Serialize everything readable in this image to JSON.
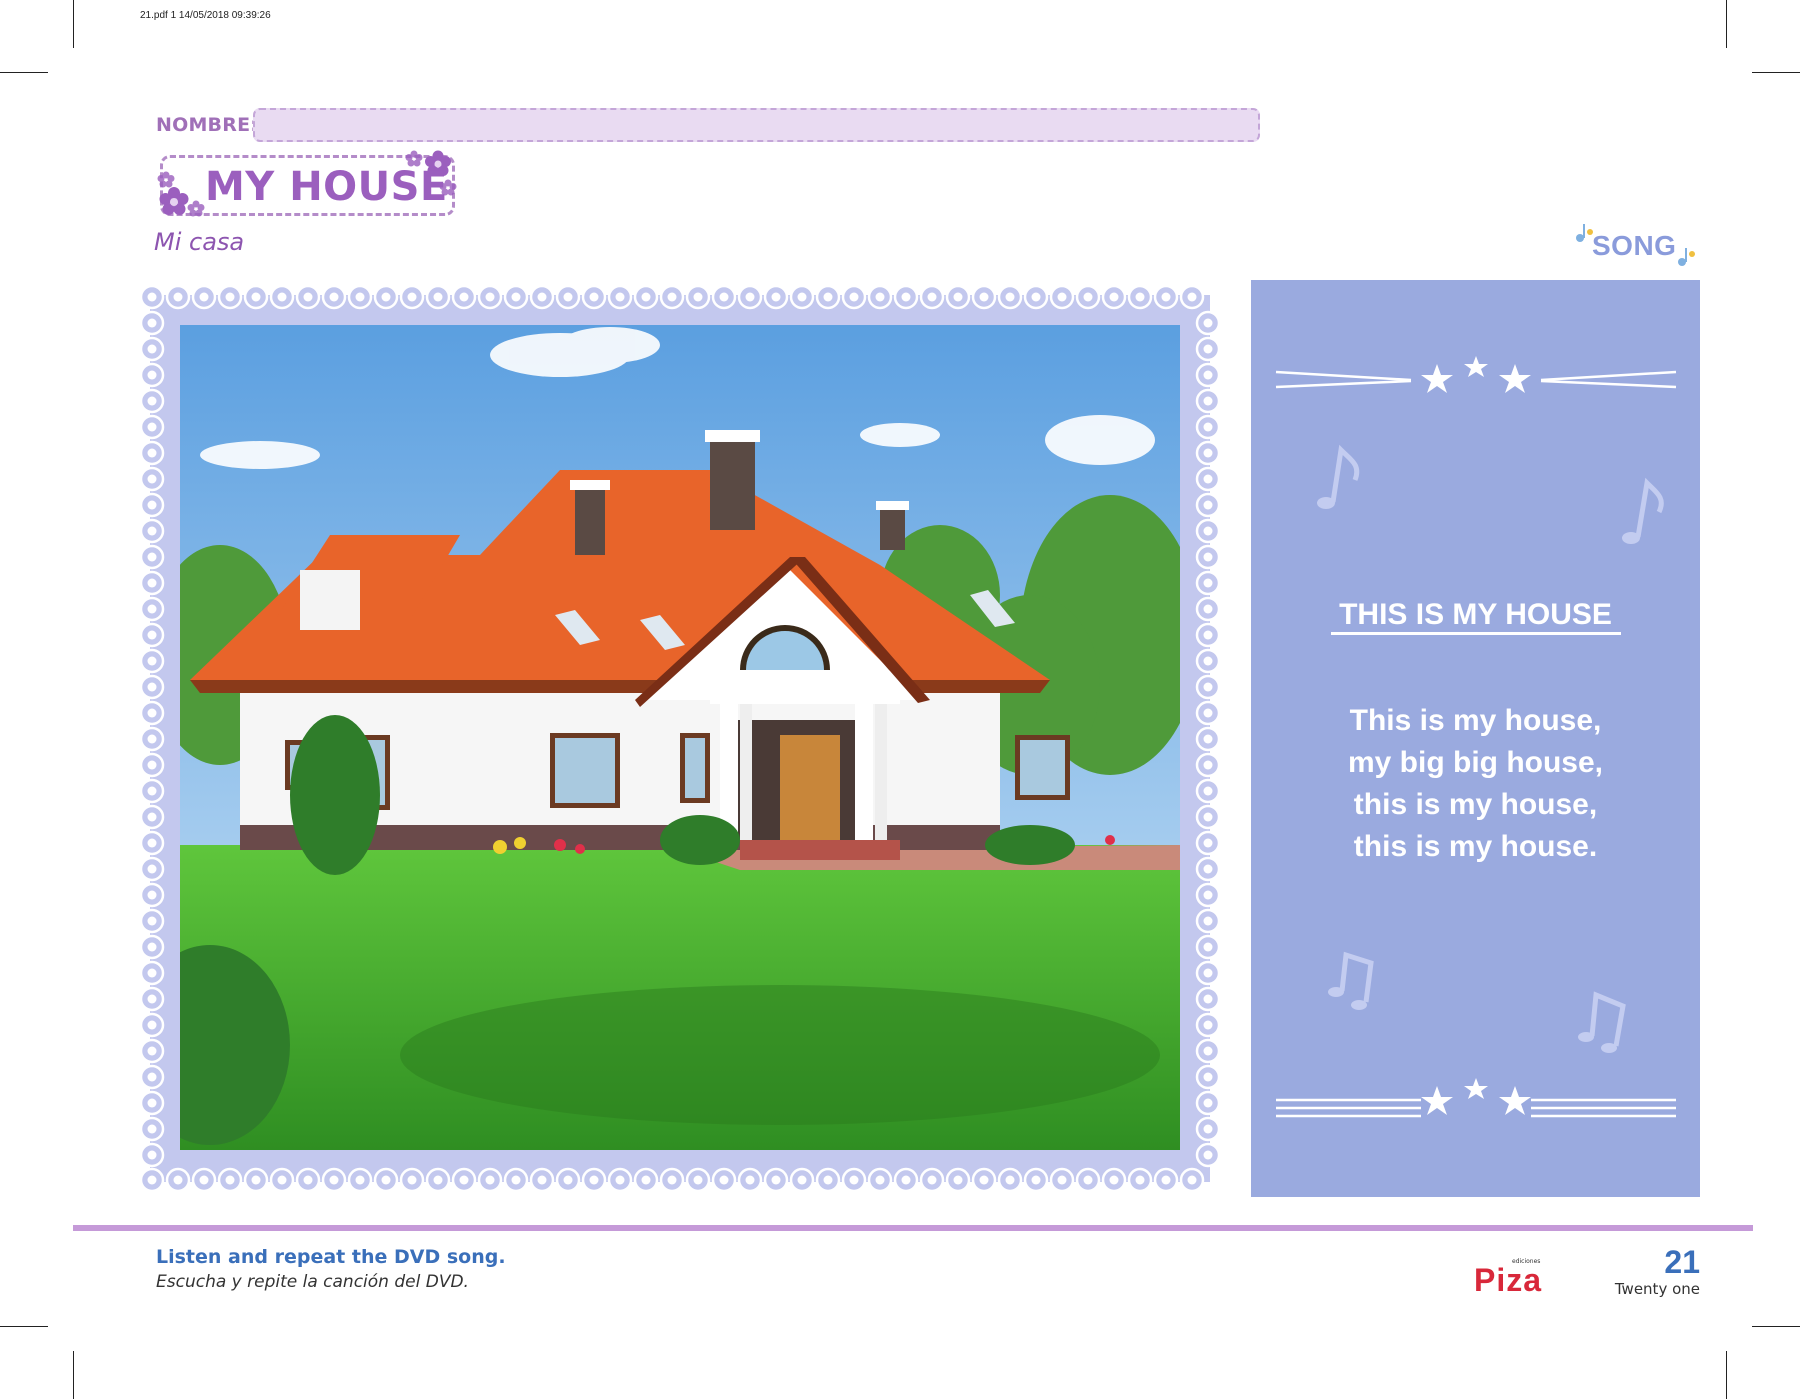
{
  "print_info": "21.pdf   1   14/05/2018   09:39:26",
  "header": {
    "name_label": "NOMBRE:",
    "title": "MY HOUSE",
    "subtitle": "Mi casa",
    "song_badge": "SONG"
  },
  "song": {
    "title": "THIS IS MY HOUSE",
    "lyrics": [
      "This is my house,",
      "my big big house,",
      "this is my house,",
      "this is my house."
    ]
  },
  "footer": {
    "instruction": "Listen and repeat the DVD song.",
    "instruction_es": "Escucha y repite la canción del DVD.",
    "publisher_small": "ediciones",
    "publisher": "Piza",
    "page_number": "21",
    "page_words": "Twenty one"
  },
  "colors": {
    "accent_purple": "#9b5fbe",
    "song_panel": "#9aaadf",
    "frame_lilac": "#c3c8ee",
    "footer_blue": "#3a6fba",
    "logo_red": "#d8283a"
  }
}
